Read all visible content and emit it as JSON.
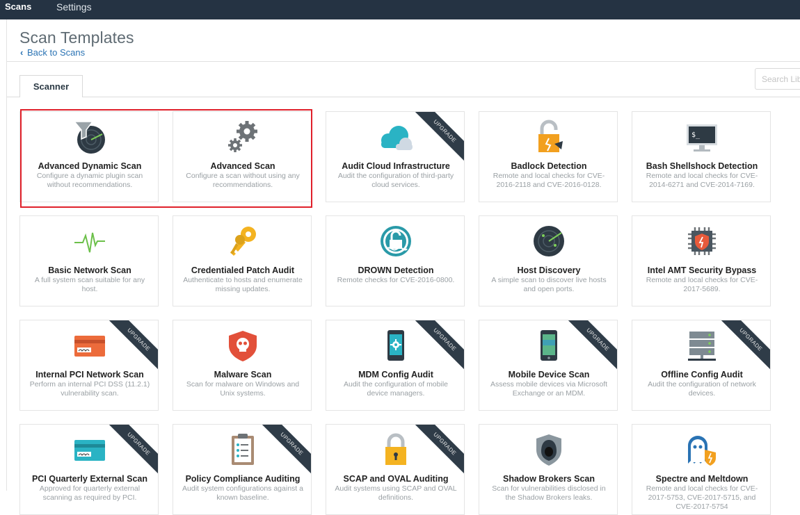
{
  "topbar": {
    "scans": "Scans",
    "settings": "Settings"
  },
  "page": {
    "title": "Scan Templates",
    "back_link": "Back to Scans"
  },
  "tabs": [
    {
      "label": "Scanner"
    }
  ],
  "search": {
    "placeholder": "Search Library"
  },
  "ribbon_label": "UPGRADE",
  "colors": {
    "topbar": "#253343",
    "link": "#2a73b4",
    "highlight": "#e0202a",
    "ribbon": "#2f3c48"
  },
  "templates": [
    {
      "title": "Advanced Dynamic Scan",
      "desc": "Configure a dynamic plugin scan without recommendations.",
      "icon": "radar-funnel-icon",
      "upgrade": false
    },
    {
      "title": "Advanced Scan",
      "desc": "Configure a scan without using any recommendations.",
      "icon": "gears-icon",
      "upgrade": false
    },
    {
      "title": "Audit Cloud Infrastructure",
      "desc": "Audit the configuration of third-party cloud services.",
      "icon": "cloud-icon",
      "upgrade": true
    },
    {
      "title": "Badlock Detection",
      "desc": "Remote and local checks for CVE-2016-2118 and CVE-2016-0128.",
      "icon": "broken-padlock-icon",
      "upgrade": false
    },
    {
      "title": "Bash Shellshock Detection",
      "desc": "Remote and local checks for CVE-2014-6271 and CVE-2014-7169.",
      "icon": "terminal-monitor-icon",
      "upgrade": false
    },
    {
      "title": "Basic Network Scan",
      "desc": "A full system scan suitable for any host.",
      "icon": "pulse-icon",
      "upgrade": false
    },
    {
      "title": "Credentialed Patch Audit",
      "desc": "Authenticate to hosts and enumerate missing updates.",
      "icon": "keys-icon",
      "upgrade": false
    },
    {
      "title": "DROWN Detection",
      "desc": "Remote checks for CVE-2016-0800.",
      "icon": "drown-lock-icon",
      "upgrade": false
    },
    {
      "title": "Host Discovery",
      "desc": "A simple scan to discover live hosts and open ports.",
      "icon": "radar-icon",
      "upgrade": false
    },
    {
      "title": "Intel AMT Security Bypass",
      "desc": "Remote and local checks for CVE-2017-5689.",
      "icon": "chip-shield-icon",
      "upgrade": false
    },
    {
      "title": "Internal PCI Network Scan",
      "desc": "Perform an internal PCI DSS (11.2.1) vulnerability scan.",
      "icon": "credit-card-red-icon",
      "upgrade": true
    },
    {
      "title": "Malware Scan",
      "desc": "Scan for malware on Windows and Unix systems.",
      "icon": "skull-shield-icon",
      "upgrade": false
    },
    {
      "title": "MDM Config Audit",
      "desc": "Audit the configuration of mobile device managers.",
      "icon": "phone-gear-icon",
      "upgrade": true
    },
    {
      "title": "Mobile Device Scan",
      "desc": "Assess mobile devices via Microsoft Exchange or an MDM.",
      "icon": "mobile-phone-icon",
      "upgrade": true
    },
    {
      "title": "Offline Config Audit",
      "desc": "Audit the configuration of network devices.",
      "icon": "server-rack-icon",
      "upgrade": true
    },
    {
      "title": "PCI Quarterly External Scan",
      "desc": "Approved for quarterly external scanning as required by PCI.",
      "icon": "credit-card-teal-icon",
      "upgrade": true
    },
    {
      "title": "Policy Compliance Auditing",
      "desc": "Audit system configurations against a known baseline.",
      "icon": "clipboard-icon",
      "upgrade": true
    },
    {
      "title": "SCAP and OVAL Auditing",
      "desc": "Audit systems using SCAP and OVAL definitions.",
      "icon": "padlock-icon",
      "upgrade": true
    },
    {
      "title": "Shadow Brokers Scan",
      "desc": "Scan for vulnerabilities disclosed in the Shadow Brokers leaks.",
      "icon": "hooded-figure-icon",
      "upgrade": false
    },
    {
      "title": "Spectre and Meltdown",
      "desc": "Remote and local checks for CVE-2017-5753, CVE-2017-5715, and CVE-2017-5754",
      "icon": "ghost-icon",
      "upgrade": false
    }
  ]
}
